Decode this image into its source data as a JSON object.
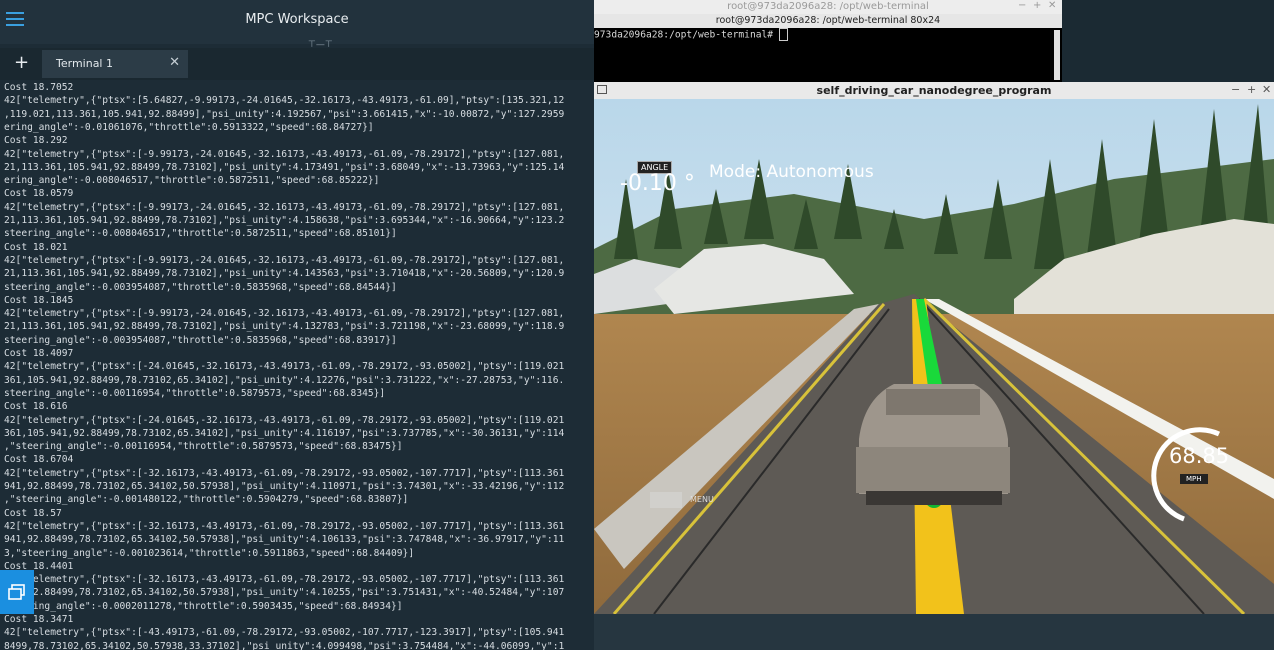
{
  "workspace": {
    "title": "MPC Workspace",
    "tick": "⊤—⊤",
    "new_tab": "+",
    "tab_label": "Terminal 1",
    "tab_close": "✕",
    "lines": [
      "Cost 18.7052",
      "42[\"telemetry\",{\"ptsx\":[5.64827,-9.99173,-24.01645,-32.16173,-43.49173,-61.09],\"ptsy\":[135.321,12",
      ",119.021,113.361,105.941,92.88499],\"psi_unity\":4.192567,\"psi\":3.661415,\"x\":-10.00872,\"y\":127.2959",
      "ering_angle\":-0.01061076,\"throttle\":0.5913322,\"speed\":68.84727}]",
      "Cost 18.292",
      "42[\"telemetry\",{\"ptsx\":[-9.99173,-24.01645,-32.16173,-43.49173,-61.09,-78.29172],\"ptsy\":[127.081,",
      "21,113.361,105.941,92.88499,78.73102],\"psi_unity\":4.173491,\"psi\":3.68049,\"x\":-13.73963,\"y\":125.14",
      "ering_angle\":-0.008046517,\"throttle\":0.5872511,\"speed\":68.85222}]",
      "Cost 18.0579",
      "42[\"telemetry\",{\"ptsx\":[-9.99173,-24.01645,-32.16173,-43.49173,-61.09,-78.29172],\"ptsy\":[127.081,",
      "21,113.361,105.941,92.88499,78.73102],\"psi_unity\":4.158638,\"psi\":3.695344,\"x\":-16.90664,\"y\":123.2",
      "steering_angle\":-0.008046517,\"throttle\":0.5872511,\"speed\":68.85101}]",
      "Cost 18.021",
      "42[\"telemetry\",{\"ptsx\":[-9.99173,-24.01645,-32.16173,-43.49173,-61.09,-78.29172],\"ptsy\":[127.081,",
      "21,113.361,105.941,92.88499,78.73102],\"psi_unity\":4.143563,\"psi\":3.710418,\"x\":-20.56809,\"y\":120.9",
      "steering_angle\":-0.003954087,\"throttle\":0.5835968,\"speed\":68.84544}]",
      "Cost 18.1845",
      "42[\"telemetry\",{\"ptsx\":[-9.99173,-24.01645,-32.16173,-43.49173,-61.09,-78.29172],\"ptsy\":[127.081,",
      "21,113.361,105.941,92.88499,78.73102],\"psi_unity\":4.132783,\"psi\":3.721198,\"x\":-23.68099,\"y\":118.9",
      "steering_angle\":-0.003954087,\"throttle\":0.5835968,\"speed\":68.83917}]",
      "Cost 18.4097",
      "42[\"telemetry\",{\"ptsx\":[-24.01645,-32.16173,-43.49173,-61.09,-78.29172,-93.05002],\"ptsy\":[119.021",
      "361,105.941,92.88499,78.73102,65.34102],\"psi_unity\":4.12276,\"psi\":3.731222,\"x\":-27.28753,\"y\":116.",
      "steering_angle\":-0.00116954,\"throttle\":0.5879573,\"speed\":68.8345}]",
      "Cost 18.616",
      "42[\"telemetry\",{\"ptsx\":[-24.01645,-32.16173,-43.49173,-61.09,-78.29172,-93.05002],\"ptsy\":[119.021",
      "361,105.941,92.88499,78.73102,65.34102],\"psi_unity\":4.116197,\"psi\":3.737785,\"x\":-30.36131,\"y\":114",
      ",\"steering_angle\":-0.00116954,\"throttle\":0.5879573,\"speed\":68.83475}]",
      "Cost 18.6704",
      "42[\"telemetry\",{\"ptsx\":[-32.16173,-43.49173,-61.09,-78.29172,-93.05002,-107.7717],\"ptsy\":[113.361",
      "941,92.88499,78.73102,65.34102,50.57938],\"psi_unity\":4.110971,\"psi\":3.74301,\"x\":-33.42196,\"y\":112",
      ",\"steering_angle\":-0.001480122,\"throttle\":0.5904279,\"speed\":68.83807}]",
      "Cost 18.57",
      "42[\"telemetry\",{\"ptsx\":[-32.16173,-43.49173,-61.09,-78.29172,-93.05002,-107.7717],\"ptsy\":[113.361",
      "941,92.88499,78.73102,65.34102,50.57938],\"psi_unity\":4.106133,\"psi\":3.747848,\"x\":-36.97917,\"y\":11",
      "3,\"steering_angle\":-0.001023614,\"throttle\":0.5911863,\"speed\":68.84409}]",
      "Cost 18.4401",
      "42[\"telemetry\",{\"ptsx\":[-32.16173,-43.49173,-61.09,-78.29172,-93.05002,-107.7717],\"ptsy\":[113.361",
      "941,92.88499,78.73102,65.34102,50.57938],\"psi_unity\":4.10255,\"psi\":3.751431,\"x\":-40.52484,\"y\":107",
      "steering_angle\":-0.0002011278,\"throttle\":0.5903435,\"speed\":68.84934}]",
      "Cost 18.3471",
      "42[\"telemetry\",{\"ptsx\":[-43.49173,-61.09,-78.29172,-93.05002,-107.7717,-123.3917],\"ptsy\":[105.941",
      "8499,78.73102,65.34102,50.57938,33.37102],\"psi_unity\":4.099498,\"psi\":3.754484,\"x\":-44.06099,\"y\":1"
    ]
  },
  "web_terminal": {
    "title": "root@973da2096a28: /opt/web-terminal",
    "subtitle": "root@973da2096a28: /opt/web-terminal 80x24",
    "prompt": "973da2096a28:/opt/web-terminal# ",
    "controls": [
      "−",
      "+",
      "✕"
    ]
  },
  "simulator": {
    "title": "self_driving_car_nanodegree_program",
    "controls": [
      "−",
      "+",
      "✕"
    ],
    "angle_label": "ANGLE",
    "angle_value": "-0.10 °",
    "mode": "Mode: Autonomous",
    "speed_value": "68.85",
    "speed_unit": "MPH",
    "menu_label": "MENU",
    "colors": {
      "waypoints": "#19d93a",
      "reference_path": "#f2c21b",
      "road": "#5e5a55"
    }
  }
}
